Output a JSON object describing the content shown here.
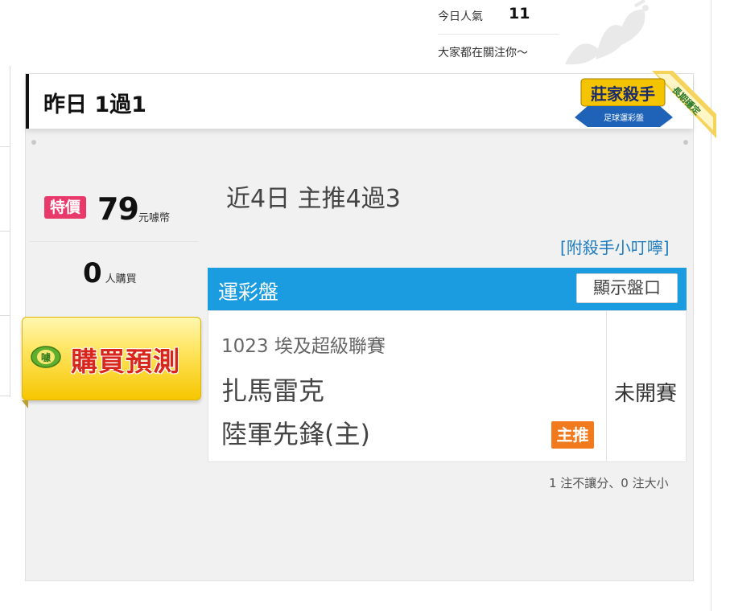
{
  "stats": {
    "popularity_label": "今日人氣",
    "popularity_value": "11",
    "tagline": "大家都在關注你～"
  },
  "card": {
    "title": "昨日 1過1",
    "badge": {
      "main_text": "莊家殺手",
      "sub_text": "足球運彩盤",
      "ribbon_text": "長期穩定"
    }
  },
  "pricing": {
    "tag": "特價",
    "price": "79",
    "unit": "元噱幣",
    "buyers": "0",
    "buyers_unit": "人購買",
    "buy_button": "購買預測",
    "coin_text": "噱"
  },
  "prediction": {
    "recent": "近4日 主推4過3",
    "note_link": "[附殺手小叮嚀]",
    "market_title": "運彩盤",
    "show_button": "顯示盤口",
    "match": {
      "league": "1023 埃及超級聯賽",
      "team1": "扎馬雷克",
      "team2": "陸軍先鋒(主)",
      "pick_badge": "主推",
      "status": "未開賽"
    },
    "footnote": "1 注不讓分、0 注大小"
  },
  "colors": {
    "accent_blue": "#1b9be0",
    "tag_pink": "#e9386a",
    "pick_orange": "#f17a1f",
    "buy_red": "#d8261d",
    "buy_yellow": "#ffe560"
  }
}
